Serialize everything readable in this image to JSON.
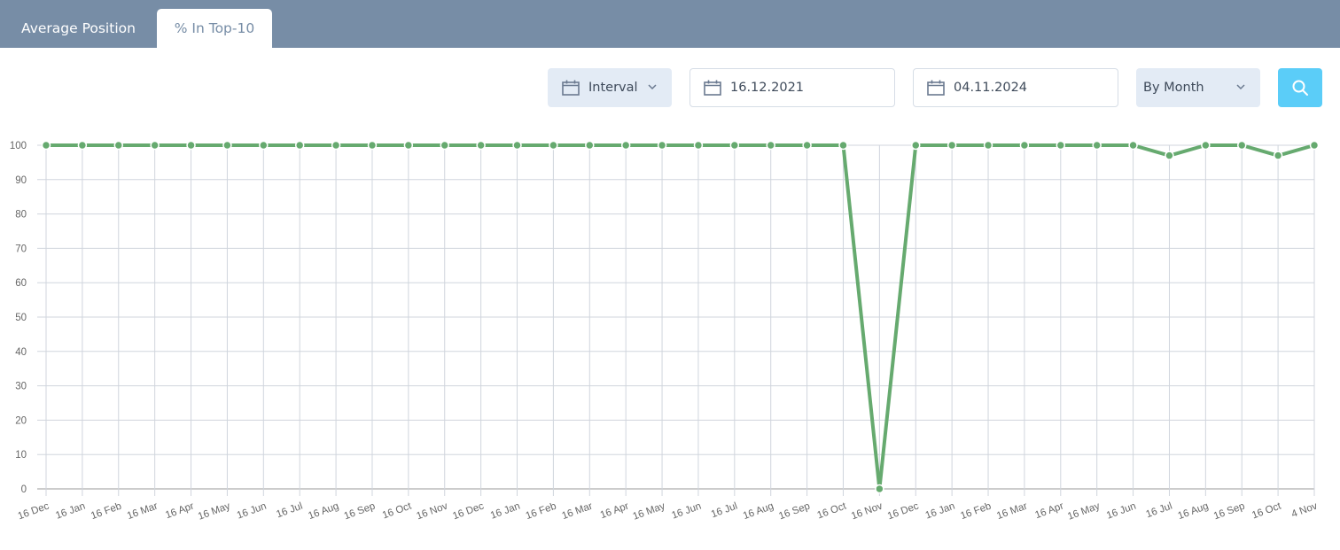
{
  "tabs": [
    {
      "label": "Average Position",
      "active": false
    },
    {
      "label": "% In Top-10",
      "active": true
    }
  ],
  "controls": {
    "interval_label": "Interval",
    "date_from": "16.12.2021",
    "date_to": "04.11.2024",
    "granularity": "By Month",
    "search_icon": "search-icon",
    "calendar_icon": "calendar-icon"
  },
  "colors": {
    "header": "#778da6",
    "line": "#66aa6f",
    "search_button": "#5bcdf8",
    "grid": "#d0d5dd"
  },
  "chart_data": {
    "type": "line",
    "title": "",
    "xlabel": "",
    "ylabel": "",
    "ylim": [
      0,
      100
    ],
    "yticks": [
      0,
      10,
      20,
      30,
      40,
      50,
      60,
      70,
      80,
      90,
      100
    ],
    "grid": true,
    "categories": [
      "16 Dec",
      "16 Jan",
      "16 Feb",
      "16 Mar",
      "16 Apr",
      "16 May",
      "16 Jun",
      "16 Jul",
      "16 Aug",
      "16 Sep",
      "16 Oct",
      "16 Nov",
      "16 Dec",
      "16 Jan",
      "16 Feb",
      "16 Mar",
      "16 Apr",
      "16 May",
      "16 Jun",
      "16 Jul",
      "16 Aug",
      "16 Sep",
      "16 Oct",
      "16 Nov",
      "16 Dec",
      "16 Jan",
      "16 Feb",
      "16 Mar",
      "16 Apr",
      "16 May",
      "16 Jun",
      "16 Jul",
      "16 Aug",
      "16 Sep",
      "16 Oct",
      "4 Nov"
    ],
    "series": [
      {
        "name": "% In Top-10",
        "values": [
          100,
          100,
          100,
          100,
          100,
          100,
          100,
          100,
          100,
          100,
          100,
          100,
          100,
          100,
          100,
          100,
          100,
          100,
          100,
          100,
          100,
          100,
          100,
          0,
          100,
          100,
          100,
          100,
          100,
          100,
          100,
          97,
          100,
          100,
          97,
          100
        ]
      }
    ]
  }
}
